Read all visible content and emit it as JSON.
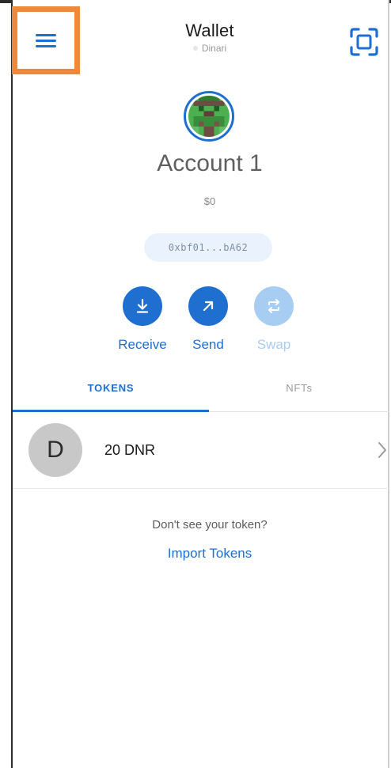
{
  "header": {
    "title": "Wallet",
    "network": "Dinari",
    "menu_icon": "hamburger-icon",
    "scan_icon": "qr-scan-icon"
  },
  "account": {
    "name": "Account 1",
    "balance": "$0",
    "address": "0xbf01...bA62",
    "avatar_icon": "pixel-avatar"
  },
  "actions": [
    {
      "label": "Receive",
      "icon": "receive-arrow-icon",
      "enabled": true
    },
    {
      "label": "Send",
      "icon": "send-arrow-icon",
      "enabled": true
    },
    {
      "label": "Swap",
      "icon": "swap-icon",
      "enabled": false
    }
  ],
  "tabs": [
    {
      "label": "TOKENS",
      "active": true
    },
    {
      "label": "NFTs",
      "active": false
    }
  ],
  "tokens": [
    {
      "icon_letter": "D",
      "amount": "20 DNR"
    }
  ],
  "import": {
    "hint": "Don't see your token?",
    "link": "Import Tokens"
  },
  "colors": {
    "accent": "#1f6fd1",
    "accent_disabled": "#a8cdf2",
    "highlight": "#f0883a"
  }
}
